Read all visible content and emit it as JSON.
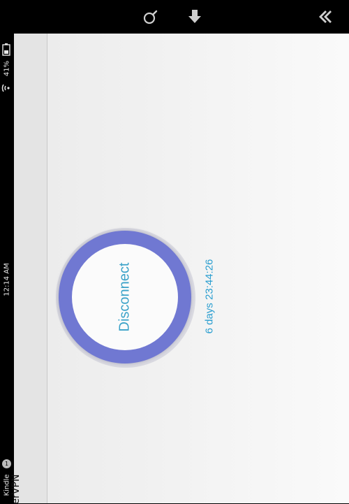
{
  "status_bar": {
    "time": "12:14 AM",
    "battery": "41%",
    "notification_app": "Kindle",
    "notification_count": "1"
  },
  "nav_bar": {
    "icons": [
      "search-icon",
      "download-icon",
      "back-icon"
    ]
  },
  "app": {
    "title": "erVPN"
  },
  "vpn": {
    "button_label": "Disconnect",
    "connected_time": "6 days 23:44:26",
    "ring_color": "#7078d2",
    "text_color": "#3aa2c8"
  }
}
